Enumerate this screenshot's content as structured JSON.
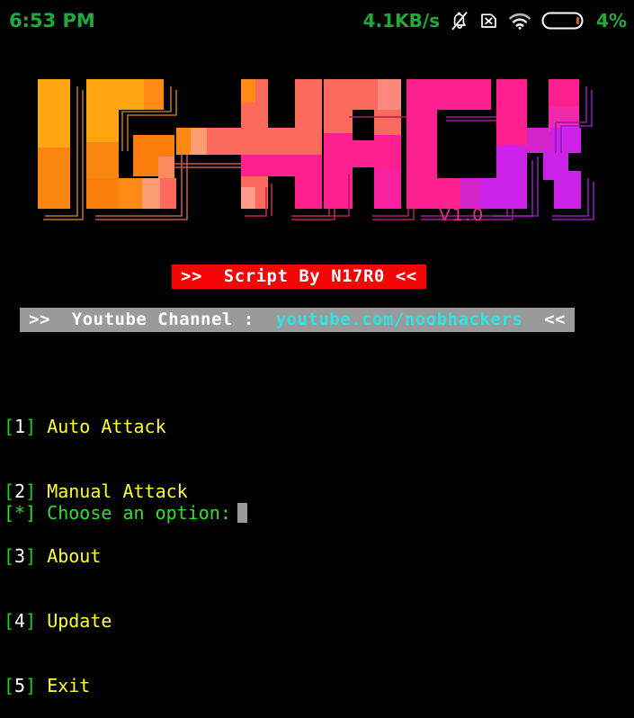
{
  "statusbar": {
    "time": "6:53 PM",
    "network_speed": "4.1KB/s",
    "battery_percent": "4%",
    "icons": {
      "bell_muted": "bell-muted-icon",
      "sim_no_card": "sim-card-x-icon",
      "wifi": "wifi-icon",
      "battery": "battery-icon"
    },
    "colors": {
      "text_green": "#1faa3c",
      "icon_white": "#ffffff"
    }
  },
  "logo": {
    "text": "IG-HACK",
    "version": "V1.0",
    "version_color": "#f0258f",
    "palette": {
      "amber": "#ffa50f",
      "orange": "#fc8a14",
      "orange_deep": "#f97e0c",
      "salmon": "#fb8063",
      "coral": "#fc6a5e",
      "pink_hot": "#ff1f8f",
      "magenta": "#f50c8a",
      "magenta_bright": "#f9219f",
      "violet": "#cc22e8",
      "purple": "#b51ff0"
    }
  },
  "banner_script": {
    "text": ">>  Script By N17R0 <<",
    "background": "#f50404",
    "foreground": "#ffffff"
  },
  "banner_youtube": {
    "prefix": ">>  Youtube Channel :  ",
    "url": "youtube.com/noobhackers",
    "suffix": "  <<",
    "background": "#9a9a9a",
    "prefix_color": "#ffffff",
    "url_color": "#2fe3e3"
  },
  "menu": {
    "bracket_color": "#1ad11a",
    "number_color": "#ffffff",
    "label_color": "#ffff2e",
    "items": [
      {
        "open": "[",
        "num": "1",
        "close": "] ",
        "label": "Auto Attack"
      },
      {
        "open": "[",
        "num": "2",
        "close": "] ",
        "label": "Manual Attack"
      },
      {
        "open": "[",
        "num": "3",
        "close": "] ",
        "label": "About"
      },
      {
        "open": "[",
        "num": "4",
        "close": "] ",
        "label": "Update"
      },
      {
        "open": "[",
        "num": "5",
        "close": "] ",
        "label": "Exit"
      }
    ]
  },
  "prompt": {
    "text": "[*] Choose an option:",
    "color": "#2ee02e",
    "cursor_color": "#9a9a9a"
  }
}
